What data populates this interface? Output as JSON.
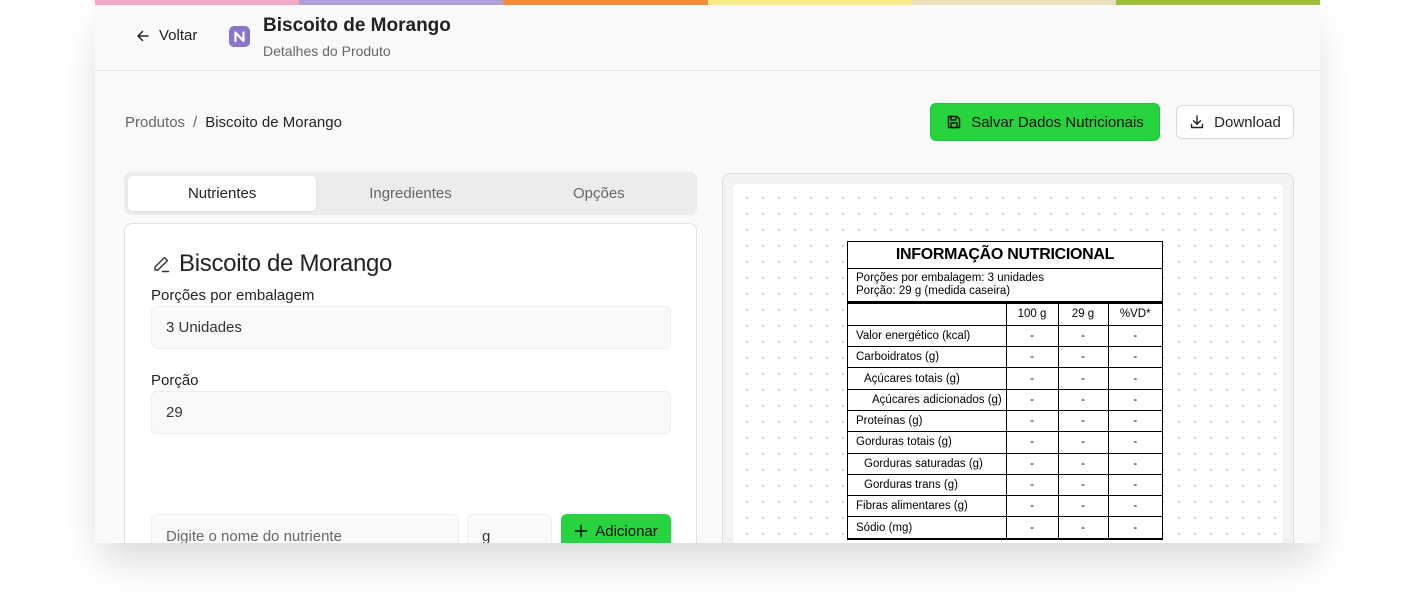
{
  "colors": {
    "rainbow": [
      "#f4a6c8",
      "#b1a0d6",
      "#ef8d3a",
      "#f5e98c",
      "#eadfbf",
      "#9cbe3a"
    ],
    "accent": "#27d33f",
    "logo": "#8b74c9"
  },
  "header": {
    "back_label": "Voltar",
    "title": "Biscoito de Morango",
    "subtitle": "Detalhes do Produto"
  },
  "breadcrumb": {
    "root": "Produtos",
    "separator": "/",
    "current": "Biscoito de Morango"
  },
  "actions": {
    "save_label": "Salvar Dados Nutricionais",
    "download_label": "Download"
  },
  "tabs": [
    {
      "label": "Nutrientes",
      "active": true
    },
    {
      "label": "Ingredientes",
      "active": false
    },
    {
      "label": "Opções",
      "active": false
    }
  ],
  "form": {
    "title": "Biscoito de Morango",
    "portions_label": "Porções por embalagem",
    "portions_value": "3 Unidades",
    "portion_label": "Porção",
    "portion_value": "29",
    "nutrient_placeholder": "Digite o nome do nutriente",
    "unit_value": "g",
    "add_label": "Adicionar"
  },
  "nutrition_label": {
    "title": "INFORMAÇÃO NUTRICIONAL",
    "portions_line": "Porções por embalagem: 3 unidades",
    "portion_line": "Porção: 29 g (medida caseira)",
    "columns": [
      "100 g",
      "29 g",
      "%VD*"
    ],
    "rows": [
      {
        "name": "Valor energético (kcal)",
        "indent": 0,
        "values": [
          "-",
          "-",
          "-"
        ]
      },
      {
        "name": "Carboidratos (g)",
        "indent": 0,
        "values": [
          "-",
          "-",
          "-"
        ]
      },
      {
        "name": "Açúcares totais (g)",
        "indent": 1,
        "values": [
          "-",
          "-",
          "-"
        ]
      },
      {
        "name": "Açúcares adicionados (g)",
        "indent": 2,
        "values": [
          "-",
          "-",
          "-"
        ]
      },
      {
        "name": "Proteínas (g)",
        "indent": 0,
        "values": [
          "-",
          "-",
          "-"
        ]
      },
      {
        "name": "Gorduras totais (g)",
        "indent": 0,
        "values": [
          "-",
          "-",
          "-"
        ]
      },
      {
        "name": "Gorduras saturadas (g)",
        "indent": 1,
        "values": [
          "-",
          "-",
          "-"
        ]
      },
      {
        "name": "Gorduras trans (g)",
        "indent": 1,
        "values": [
          "-",
          "-",
          "-"
        ]
      },
      {
        "name": "Fibras alimentares (g)",
        "indent": 0,
        "values": [
          "-",
          "-",
          "-"
        ]
      },
      {
        "name": "Sódio (mg)",
        "indent": 0,
        "values": [
          "-",
          "-",
          "-"
        ]
      }
    ]
  }
}
